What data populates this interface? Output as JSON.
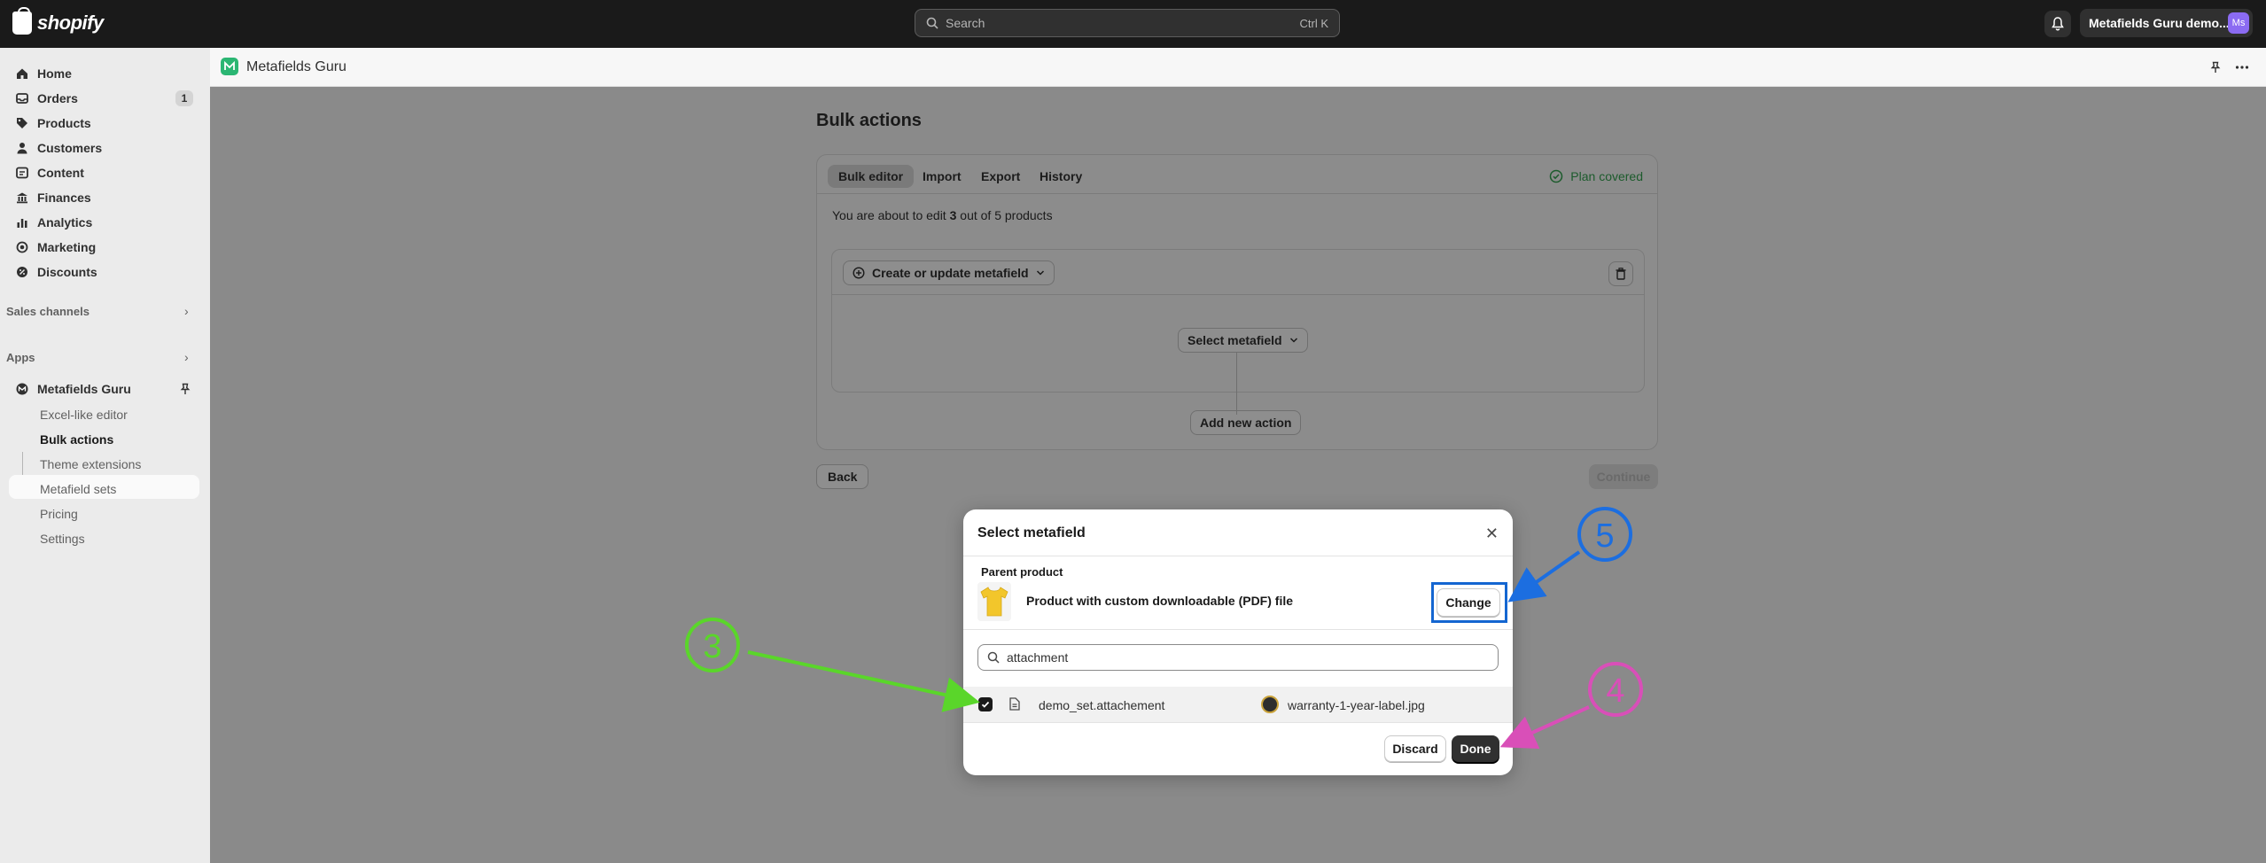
{
  "topbar": {
    "logo_text": "shopify",
    "search_placeholder": "Search",
    "search_shortcut": "Ctrl K",
    "store_name": "Metafields Guru demo...",
    "avatar_initials": "Ms"
  },
  "sidebar": {
    "items": [
      {
        "label": "Home",
        "icon": "home-icon"
      },
      {
        "label": "Orders",
        "icon": "inbox-icon",
        "badge": "1"
      },
      {
        "label": "Products",
        "icon": "tag-icon"
      },
      {
        "label": "Customers",
        "icon": "person-icon"
      },
      {
        "label": "Content",
        "icon": "content-icon"
      },
      {
        "label": "Finances",
        "icon": "bank-icon"
      },
      {
        "label": "Analytics",
        "icon": "bar-chart-icon"
      },
      {
        "label": "Marketing",
        "icon": "target-icon"
      },
      {
        "label": "Discounts",
        "icon": "discount-icon"
      }
    ],
    "sales_channels": "Sales channels",
    "apps": "Apps",
    "app_name": "Metafields Guru",
    "app_subitems": [
      "Excel-like editor",
      "Bulk actions",
      "Theme extensions",
      "Metafield sets",
      "Pricing",
      "Settings"
    ]
  },
  "app_header": {
    "title": "Metafields Guru"
  },
  "page": {
    "title": "Bulk actions",
    "tabs": [
      "Bulk editor",
      "Import",
      "Export",
      "History"
    ],
    "plan_status": "Plan covered",
    "edit_prefix": "You are about to edit ",
    "edit_count": "3",
    "edit_suffix": " out of 5 products",
    "create_action": "Create or update metafield",
    "select_metafield": "Select metafield",
    "add_action": "Add new action",
    "back": "Back",
    "continue": "Continue"
  },
  "modal": {
    "title": "Select metafield",
    "parent_label": "Parent product",
    "product_name": "Product with custom downloadable (PDF) file",
    "change": "Change",
    "search_value": "attachment",
    "result_key": "demo_set.attachement",
    "result_value": "warranty-1-year-label.jpg",
    "discard": "Discard",
    "done": "Done"
  },
  "annotations": [
    {
      "label": "3",
      "color": "#5ad62a"
    },
    {
      "label": "4",
      "color": "#d94fb8"
    },
    {
      "label": "5",
      "color": "#1c6ee0"
    }
  ]
}
